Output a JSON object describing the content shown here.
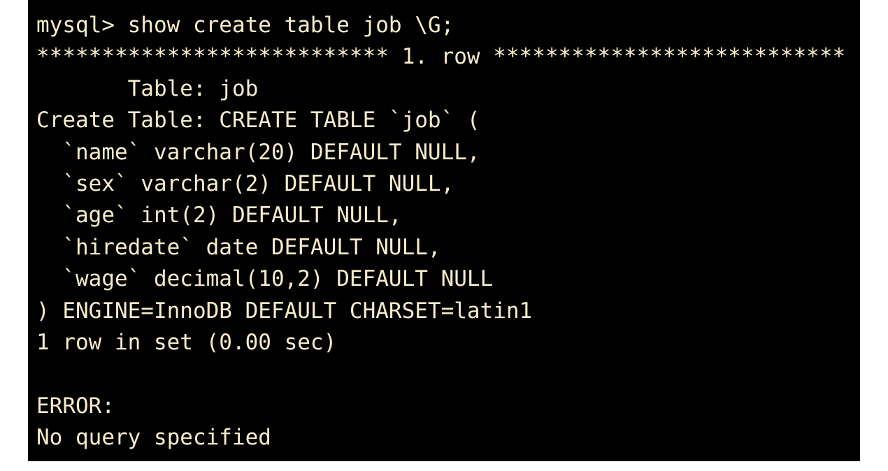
{
  "terminal": {
    "text_color": "#f7ecca",
    "background_color": "#000000",
    "lines": [
      "mysql> show create table job \\G;",
      "*************************** 1. row ***************************",
      "       Table: job",
      "Create Table: CREATE TABLE `job` (",
      "  `name` varchar(20) DEFAULT NULL,",
      "  `sex` varchar(2) DEFAULT NULL,",
      "  `age` int(2) DEFAULT NULL,",
      "  `hiredate` date DEFAULT NULL,",
      "  `wage` decimal(10,2) DEFAULT NULL",
      ") ENGINE=InnoDB DEFAULT CHARSET=latin1",
      "1 row in set (0.00 sec)",
      "",
      "ERROR:",
      "No query specified"
    ]
  }
}
